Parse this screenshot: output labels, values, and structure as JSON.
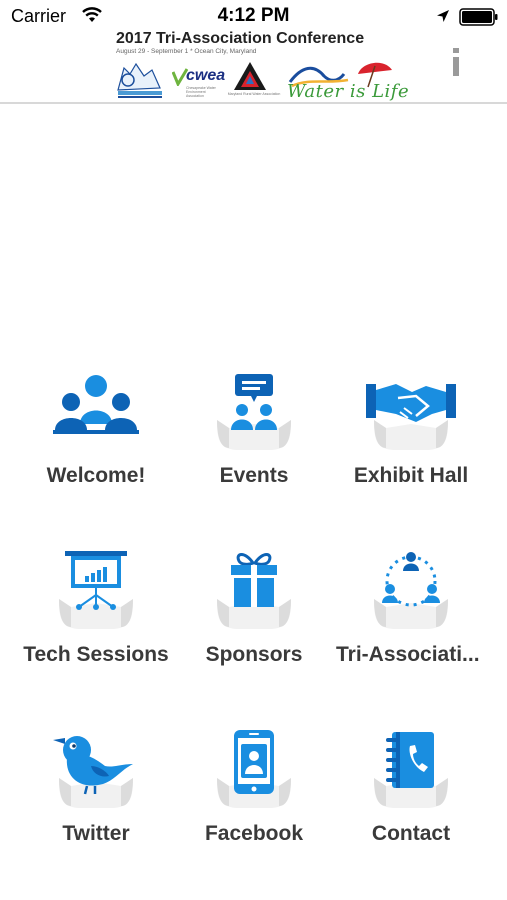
{
  "status_bar": {
    "carrier": "Carrier",
    "time": "4:12 PM"
  },
  "banner": {
    "title": "2017 Tri-Association Conference",
    "subtitle": "August 29 - September 1  *  Ocean City, Maryland",
    "logo_cwea": "cwea",
    "logo_cwea_tagline": "Chesapeake Water Environment Association",
    "logo_triangle_caption": "Maryland Rural Water Association",
    "water_is_life": "Water is Life"
  },
  "tiles": [
    {
      "label": "Welcome!",
      "icon": "group-icon"
    },
    {
      "label": "Events",
      "icon": "presentation-audience-icon"
    },
    {
      "label": "Exhibit Hall",
      "icon": "handshake-icon"
    },
    {
      "label": "Tech Sessions",
      "icon": "easel-chart-icon"
    },
    {
      "label": "Sponsors",
      "icon": "gift-icon"
    },
    {
      "label": "Tri-Associati...",
      "icon": "network-people-icon"
    },
    {
      "label": "Twitter",
      "icon": "bird-icon"
    },
    {
      "label": "Facebook",
      "icon": "phone-user-icon"
    },
    {
      "label": "Contact",
      "icon": "address-book-icon"
    }
  ],
  "colors": {
    "icon_dark_blue": "#0d63b5",
    "icon_light_blue": "#1a8ee0",
    "label_text": "#3a3a3a",
    "water_is_life_green": "#3b9a3a"
  }
}
